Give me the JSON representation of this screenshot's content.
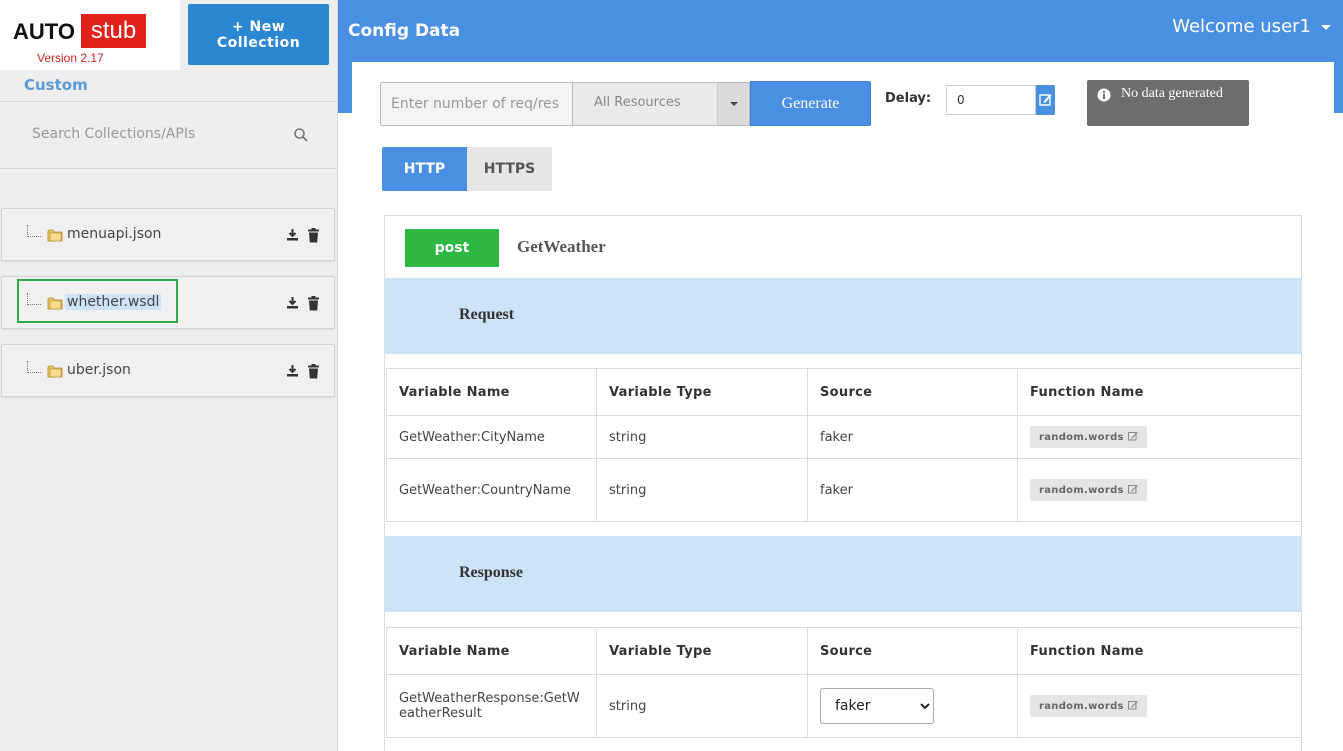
{
  "logo": {
    "auto": "AUTO",
    "stub": "stub",
    "version": "Version 2.17"
  },
  "sidebar": {
    "new_collection_line1": "+ New",
    "new_collection_line2": "Collection",
    "section_label": "Custom",
    "search_placeholder": "Search Collections/APIs",
    "collections": [
      {
        "name": "menuapi.json"
      },
      {
        "name": "whether.wsdl",
        "selected": true
      },
      {
        "name": "uber.json"
      }
    ]
  },
  "header": {
    "title": "Config Data",
    "welcome": "Welcome user1"
  },
  "toolbar": {
    "req_placeholder": "Enter number of req/res",
    "resource_selected": "All Resources",
    "generate_label": "Generate",
    "delay_label": "Delay:",
    "delay_value": "0",
    "status_text": "No data generated"
  },
  "tabs": {
    "http": "HTTP",
    "https": "HTTPS",
    "active": "HTTP"
  },
  "api": {
    "method": "post",
    "name": "GetWeather",
    "request": {
      "title": "Request",
      "columns": [
        "Variable Name",
        "Variable Type",
        "Source",
        "Function Name"
      ],
      "rows": [
        {
          "name": "GetWeather:CityName",
          "type": "string",
          "source": "faker",
          "function": "random.words"
        },
        {
          "name": "GetWeather:CountryName",
          "type": "string",
          "source": "faker",
          "function": "random.words"
        }
      ]
    },
    "response": {
      "title": "Response",
      "columns": [
        "Variable Name",
        "Variable Type",
        "Source",
        "Function Name"
      ],
      "rows": [
        {
          "name": "GetWeatherResponse:GetWeatherResult",
          "type": "string",
          "source": "faker",
          "function": "random.words"
        }
      ]
    }
  },
  "colors": {
    "header_blue": "#4a90e2",
    "button_blue": "#2b87d1",
    "post_green": "#2db843",
    "band_blue": "#cde3f7",
    "logo_red": "#e0221b",
    "select_green": "#2aa84a"
  },
  "icons": [
    "search-icon",
    "folder-icon",
    "download-icon",
    "trash-icon",
    "edit-icon",
    "info-icon",
    "chevron-down-icon"
  ]
}
